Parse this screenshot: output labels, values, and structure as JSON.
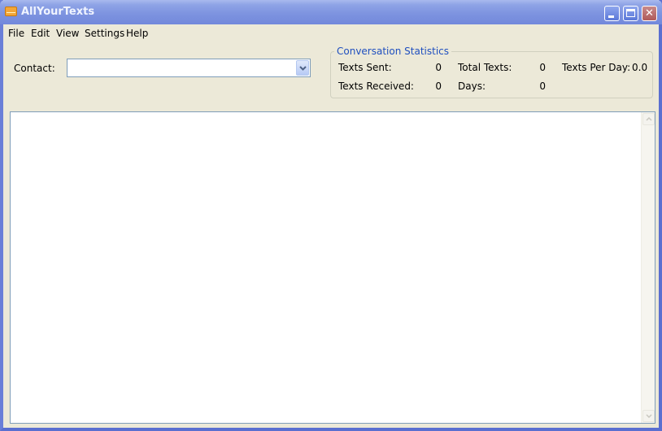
{
  "window": {
    "title": "AllYourTexts",
    "icon": "envelope-icon",
    "controls": [
      "minimize",
      "maximize",
      "close"
    ]
  },
  "menu": [
    "File",
    "Edit",
    "View",
    "Settings",
    "Help"
  ],
  "contact": {
    "label": "Contact:",
    "value": ""
  },
  "stats": {
    "title": "Conversation Statistics",
    "texts_sent_label": "Texts Sent:",
    "texts_sent": "0",
    "texts_received_label": "Texts Received:",
    "texts_received": "0",
    "total_texts_label": "Total Texts:",
    "total_texts": "0",
    "days_label": "Days:",
    "days": "0",
    "texts_per_day_label": "Texts Per Day:",
    "texts_per_day": "0.0"
  },
  "conversation": {
    "content": ""
  }
}
